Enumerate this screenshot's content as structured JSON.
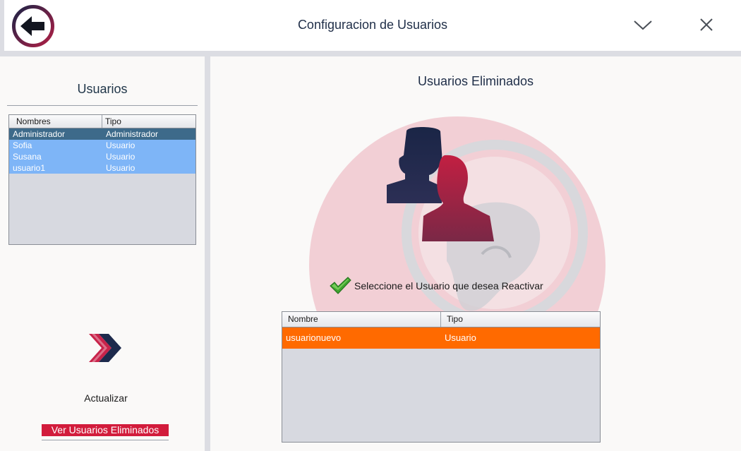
{
  "window": {
    "title": "Configuracion de Usuarios",
    "back_icon": "arrow-left-icon",
    "minimize_icon": "chevron-down-icon",
    "close_icon": "close-icon"
  },
  "sidebar": {
    "title": "Usuarios",
    "table": {
      "columns": [
        "Nombres",
        "Tipo"
      ],
      "rows": [
        {
          "name": "Administrador",
          "type": "Administrador",
          "selected": true
        },
        {
          "name": "Sofia",
          "type": "Usuario",
          "selected": false
        },
        {
          "name": "Susana",
          "type": "Usuario",
          "selected": false
        },
        {
          "name": "usuario1",
          "type": "Usuario",
          "selected": false
        }
      ]
    },
    "refresh_icon": "double-chevron-right-icon",
    "refresh_label": "Actualizar",
    "deleted_button": "Ver Usuarios Eliminados"
  },
  "main": {
    "title": "Usuarios Eliminados",
    "hint": "Seleccione el Usuario que desea Reactivar",
    "hint_icon": "check-icon",
    "table": {
      "columns": [
        "Nombre",
        "Tipo"
      ],
      "rows": [
        {
          "name": "usuarionuevo",
          "type": "Usuario",
          "selected": true
        }
      ]
    }
  },
  "colors": {
    "accent_red": "#d21c3c",
    "selected_row_orange": "#ff6a00",
    "row_blue": "#7eb5f7",
    "selected_row_dark": "#3d6a8a"
  }
}
